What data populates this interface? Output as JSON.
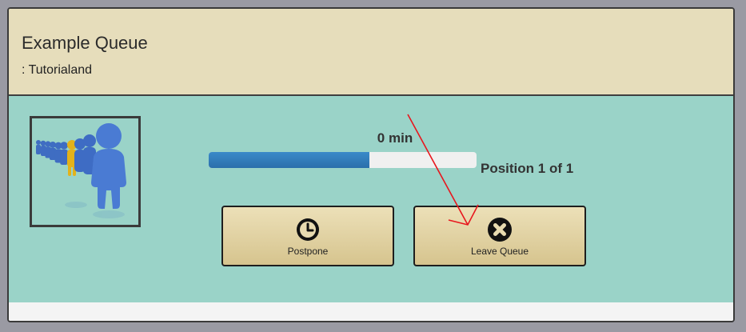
{
  "queue": {
    "title": "Example Queue",
    "subtitle": ": Tutorialand"
  },
  "status": {
    "wait_time": "0 min",
    "position_text": "Position 1 of 1",
    "progress_fraction": 0.6
  },
  "actions": {
    "postpone_label": "Postpone",
    "postpone_icon": "clock-icon",
    "leave_label": "Leave Queue",
    "leave_icon": "close-circle-icon"
  },
  "colors": {
    "header_bg": "#e6ddbb",
    "content_bg": "#9ad3c8",
    "progress_fill": "#2f7bbd",
    "annotation_arrow": "#e8161d"
  }
}
